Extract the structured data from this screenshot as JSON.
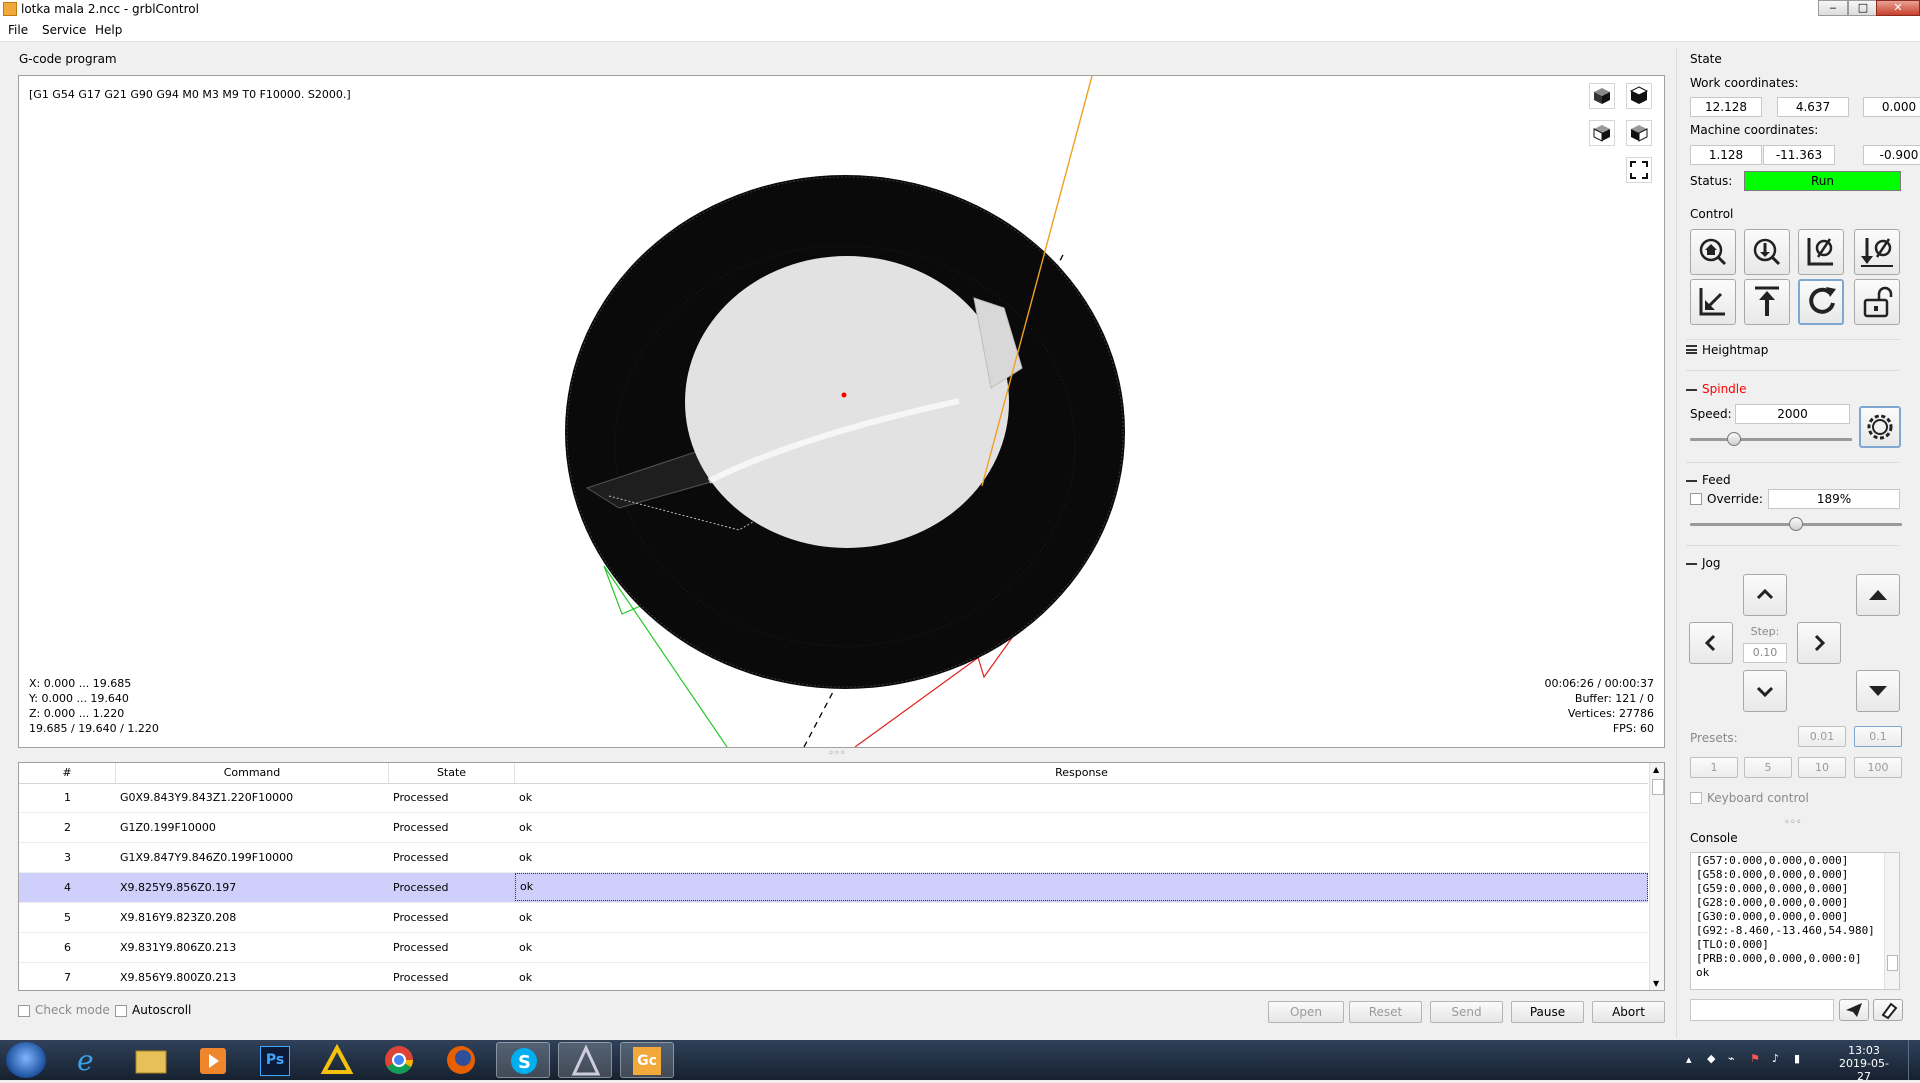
{
  "window": {
    "title": "lotka mala 2.ncc - grblControl",
    "minimize_glyph": "‒",
    "maximize_glyph": "□",
    "close_glyph": "✕"
  },
  "menu": [
    "File",
    "Service",
    "Help"
  ],
  "program": {
    "group_label": "G-code program",
    "parser_state": "[G1 G54 G17 G21 G90 G94 M0 M3 M9 T0 F10000. S2000.]",
    "bounds": [
      "X: 0.000 ... 19.685",
      "Y: 0.000 ... 19.640",
      "Z: 0.000 ... 1.220",
      "19.685 / 19.640 / 1.220"
    ],
    "stats": [
      "00:06:26 / 00:00:37",
      "Buffer: 121 / 0",
      "Vertices: 27786",
      "FPS: 60"
    ],
    "splitter_glyph": "◦◦◦"
  },
  "table": {
    "headers": [
      "#",
      "Command",
      "State",
      "Response"
    ],
    "rows": [
      {
        "n": "1",
        "command": "G0X9.843Y9.843Z1.220F10000",
        "state": "Processed",
        "response": "ok"
      },
      {
        "n": "2",
        "command": "G1Z0.199F10000",
        "state": "Processed",
        "response": "ok"
      },
      {
        "n": "3",
        "command": "G1X9.847Y9.846Z0.199F10000",
        "state": "Processed",
        "response": "ok"
      },
      {
        "n": "4",
        "command": "X9.825Y9.856Z0.197",
        "state": "Processed",
        "response": "ok"
      },
      {
        "n": "5",
        "command": "X9.816Y9.823Z0.208",
        "state": "Processed",
        "response": "ok"
      },
      {
        "n": "6",
        "command": "X9.831Y9.806Z0.213",
        "state": "Processed",
        "response": "ok"
      },
      {
        "n": "7",
        "command": "X9.856Y9.800Z0.213",
        "state": "Processed",
        "response": "ok"
      }
    ],
    "selected_row": "4"
  },
  "bottom": {
    "check_mode": "Check mode",
    "autoscroll": "Autoscroll",
    "open": "Open",
    "reset": "Reset",
    "send": "Send",
    "pause": "Pause",
    "abort": "Abort"
  },
  "state": {
    "title": "State",
    "work_label": "Work coordinates:",
    "work": [
      "12.128",
      "4.637",
      "0.000"
    ],
    "machine_label": "Machine coordinates:",
    "machine": [
      "1.128",
      "-11.363",
      "-0.900"
    ],
    "status_label": "Status:",
    "status": "Run",
    "status_color": "#00ff00"
  },
  "control": {
    "title": "Control",
    "buttons": [
      "home-icon",
      "zero-probe-icon",
      "zero-xy-icon",
      "zero-z-icon",
      "restore-origin-icon",
      "safe-position-icon",
      "reset-icon",
      "unlock-icon"
    ]
  },
  "heightmap": {
    "title": "Heightmap"
  },
  "spindle": {
    "title": "Spindle",
    "title_color": "#ff0000",
    "speed_label": "Speed:",
    "speed": "2000",
    "slider_fraction": 0.25
  },
  "feed": {
    "title": "Feed",
    "override_label": "Override:",
    "override": "189%",
    "slider_fraction": 0.5
  },
  "jog": {
    "title": "Jog",
    "step_label": "Step:",
    "step": "0.10",
    "presets_label": "Presets:",
    "presets_row1": [
      "0.01",
      "0.1"
    ],
    "presets_row2": [
      "1",
      "5",
      "10",
      "100"
    ],
    "keyboard_control": "Keyboard control"
  },
  "console": {
    "title": "Console",
    "lines": [
      "[G57:0.000,0.000,0.000]",
      "[G58:0.000,0.000,0.000]",
      "[G59:0.000,0.000,0.000]",
      "[G28:0.000,0.000,0.000]",
      "[G30:0.000,0.000,0.000]",
      "[G92:-8.460,-13.460,54.980]",
      "[TLO:0.000]",
      "[PRB:0.000,0.000,0.000:0]",
      "ok"
    ]
  },
  "taskbar": {
    "apps": [
      "windows-start-icon",
      "internet-explorer-icon",
      "file-explorer-icon",
      "media-player-icon",
      "photoshop-icon",
      "warning-app-icon",
      "chrome-icon",
      "firefox-icon",
      "skype-icon",
      "cad-app-icon",
      "grblcontrol-icon"
    ],
    "ps_label": "Ps",
    "gc_label": "Gc",
    "time": "13:03",
    "date": "2019-05-27"
  }
}
